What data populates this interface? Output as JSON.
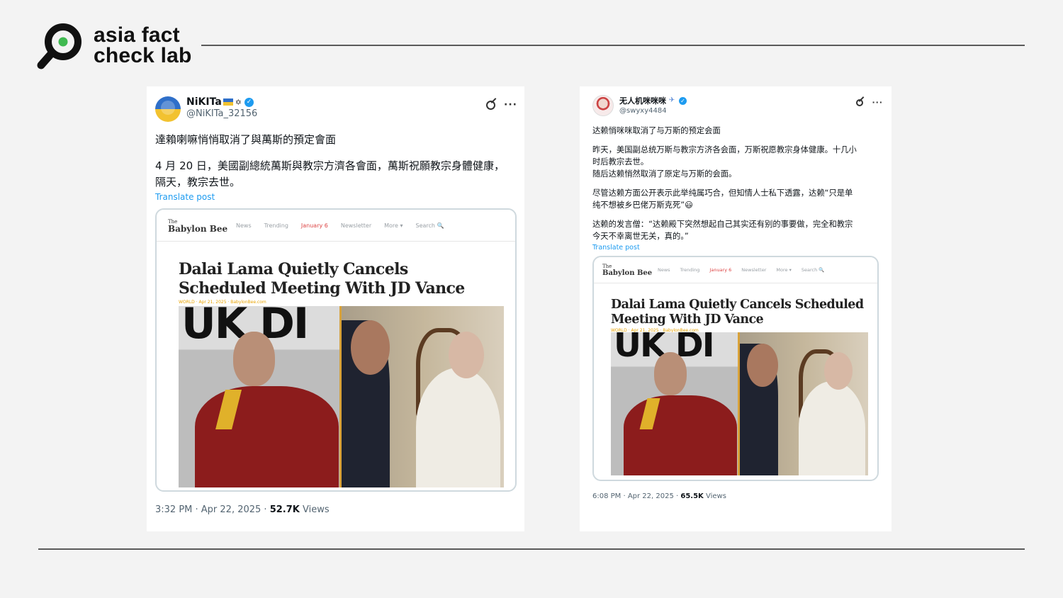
{
  "brand": {
    "name_line1": "asia fact",
    "name_line2": "check lab"
  },
  "tweets": [
    {
      "display_name": "NiKITa",
      "flag2": "✡",
      "handle": "@NiKITa_32156",
      "title_line": "達賴喇嘛悄悄取消了與萬斯的預定會面",
      "body": "4 月 20 日，美國副總統萬斯與教宗方濟各會面，萬斯祝願教宗身體健康，\n隔天，教宗去世。",
      "translate": "Translate post",
      "preview": {
        "logo_top": "The",
        "logo_main": "Babylon Bee",
        "nav": [
          "News",
          "Trending",
          "January 6",
          "Newsletter",
          "More ▾",
          "Search 🔍"
        ],
        "headline": "Dalai Lama Quietly Cancels Scheduled Meeting With JD Vance",
        "byline": "WORLD · Apr 21, 2025 · BabylonBee.com",
        "bg_letters": "UK DI"
      },
      "time": "3:32 PM · Apr 22, 2025 · ",
      "views_count": "52.7K",
      "views_label": " Views"
    },
    {
      "display_name": "无人机咪咪咪",
      "flag": "✈",
      "handle": "@swyxy4484",
      "title_line": "达赖悄咪咪取消了与万斯的预定会面",
      "body1": "昨天，美国副总统万斯与教宗方济各会面，万斯祝愿教宗身体健康。十几小\n时后教宗去世。\n随后达赖悄然取消了原定与万斯的会面。",
      "body2": "尽管达赖方面公开表示此举纯属巧合，但知情人士私下透露，达赖“只是单\n纯不想被乡巴佬万斯克死”😃",
      "body3": "达赖的发言僧：“达赖殿下突然想起自己其实还有别的事要做，完全和教宗\n今天不幸离世无关，真的。”",
      "translate": "Translate post",
      "preview": {
        "logo_top": "The",
        "logo_main": "Babylon Bee",
        "nav": [
          "News",
          "Trending",
          "January 6",
          "Newsletter",
          "More ▾",
          "Search 🔍"
        ],
        "headline": "Dalai Lama Quietly Cancels Scheduled Meeting With JD Vance",
        "byline": "WORLD · Apr 21, 2025 · BabylonBee.com",
        "bg_letters": "UK DI"
      },
      "time": "6:08 PM · Apr 22, 2025 · ",
      "views_count": "65.5K",
      "views_label": " Views"
    }
  ]
}
